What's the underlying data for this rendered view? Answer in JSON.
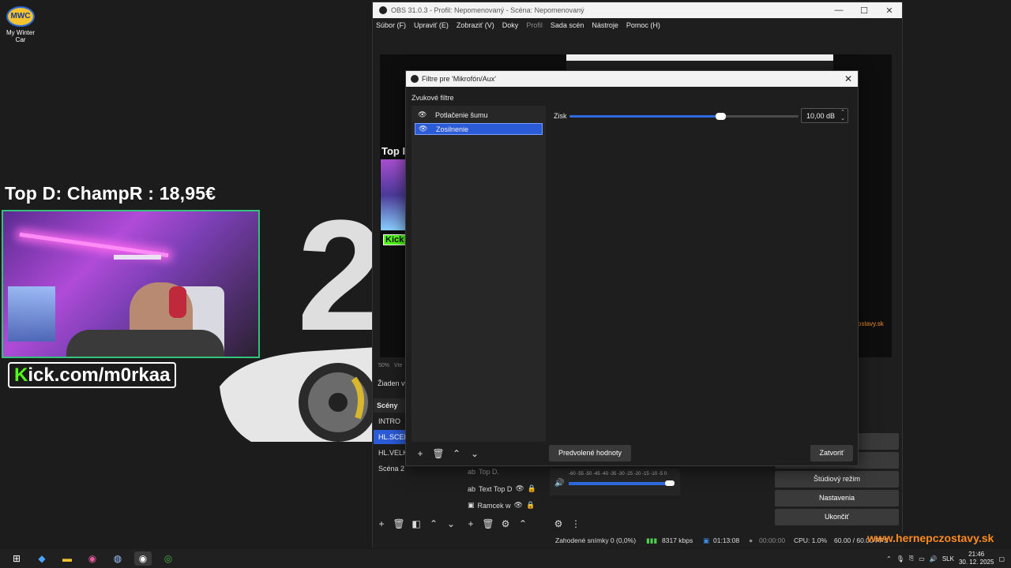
{
  "desktop": {
    "icon_label_1": "My Winter",
    "icon_label_2": "Car",
    "icon_badge": "MWC",
    "overlay_title": "Top D: ChampR : 18,95€",
    "kick_prefix": "K",
    "kick_rest": "ick.com/m0rkaa",
    "big_number": "2",
    "watermark": "www.hernepczostavy.sk"
  },
  "obs": {
    "title": "OBS 31.0.3 - Profil: Nepomenovaný - Scéna: Nepomenovaný",
    "window_controls": [
      "—",
      "☐",
      "✕"
    ],
    "menu": [
      {
        "label": "Súbor (F)",
        "dim": false
      },
      {
        "label": "Upraviť (E)",
        "dim": false
      },
      {
        "label": "Zobraziť (V)",
        "dim": false
      },
      {
        "label": "Doky",
        "dim": false
      },
      {
        "label": "Profil",
        "dim": true
      },
      {
        "label": "Sada scén",
        "dim": false
      },
      {
        "label": "Nástroje",
        "dim": false
      },
      {
        "label": "Pomoc (H)",
        "dim": false
      }
    ],
    "preview": {
      "top_label": "Top I",
      "kick_label": "Kick",
      "site_label": "ostavy.sk"
    },
    "zoom": "50%",
    "zoom_extra": "Vte",
    "no_selection": "Žiaden vy",
    "scenes_header": "Scény",
    "scenes": [
      {
        "label": "INTRO",
        "active": false
      },
      {
        "label": "HL.SCEN",
        "active": true
      },
      {
        "label": "HL.VELKA",
        "active": false
      },
      {
        "label": "Scéna 2",
        "active": false
      }
    ],
    "sources": [
      {
        "label": "Top D.",
        "icon": "ab"
      },
      {
        "label": "Text Top D",
        "icon": "ab"
      },
      {
        "label": "Ramcek w",
        "icon": "img"
      }
    ],
    "mixer_scale": "-60 -55 -50 -45 -40 -35 -30 -25 -20 -15 -10 -5 0",
    "mixer_level": 1.0,
    "controls": {
      "partial_1": "ie",
      "partial_2": "ru",
      "studio_mode": "Štúdiový režim",
      "settings": "Nastavenia",
      "exit": "Ukončiť"
    },
    "status": {
      "dropped": "Zahodené snímky 0 (0,0%)",
      "bitrate": "8317 kbps",
      "stream_time": "01:13:08",
      "rec_time": "00:00:00",
      "cpu": "CPU: 1.0%",
      "fps": "60.00 / 60.00 FPS"
    }
  },
  "dialog": {
    "title": "Filtre pre 'Mikrofón/Aux'",
    "section_label": "Zvukové filtre",
    "filters": [
      {
        "label": "Potlačenie šumu",
        "active": false
      },
      {
        "label": "Zosilnenie",
        "active": true
      }
    ],
    "gain_label": "Zisk",
    "gain_value": "10,00 dB",
    "gain_level": 0.66,
    "defaults_button": "Predvolené hodnoty",
    "close_button": "Zatvoriť"
  },
  "taskbar": {
    "lang": "SLK",
    "time": "21:46",
    "date": "30. 12. 2025"
  },
  "colors": {
    "accent": "#2b5bd7",
    "kick_green": "#53fc18",
    "watermark": "#ff8a1e"
  }
}
